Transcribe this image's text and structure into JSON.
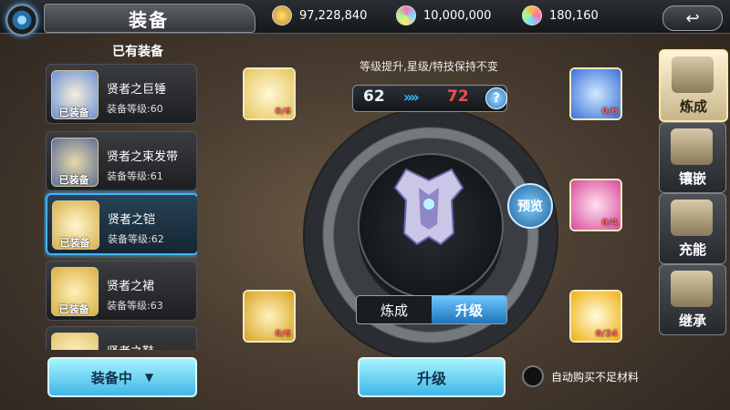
{
  "header": {
    "title": "装备",
    "currencies": [
      {
        "icon": "gold-coin-icon",
        "value": "97,228,840"
      },
      {
        "icon": "crystal-icon",
        "value": "10,000,000"
      },
      {
        "icon": "rainbow-gem-icon",
        "value": "180,160"
      }
    ]
  },
  "owned": {
    "header": "已有装备",
    "items": [
      {
        "name": "贤者之巨锤",
        "level": "装备等级:60",
        "equipped": "已装备",
        "color": "#6a8fd8"
      },
      {
        "name": "贤者之束发带",
        "level": "装备等级:61",
        "equipped": "已装备",
        "color": "#5c6f9a"
      },
      {
        "name": "贤者之铠",
        "level": "装备等级:62",
        "equipped": "已装备",
        "color": "#d9b14a"
      },
      {
        "name": "贤者之裙",
        "level": "装备等级:63",
        "equipped": "已装备",
        "color": "#d8b042"
      },
      {
        "name": "贤者之鞋",
        "level": "",
        "equipped": "",
        "color": "#e6c66a"
      }
    ],
    "equipping_label": "装备中",
    "equipping_arrow": "▼"
  },
  "upgrade": {
    "note": "等级提升,星级/特技保持不变",
    "level_from": "62",
    "level_arrows": "»»",
    "level_to": "72",
    "help": "?",
    "preview": "预览",
    "tabs": [
      "炼成",
      "升级"
    ],
    "active_tab": 1,
    "button": "升级",
    "auto_buy": "自动购买不足材料"
  },
  "materials": [
    {
      "icon": "scroll-icon",
      "count": "0/6"
    },
    {
      "icon": "blue-crystal-icon",
      "count": "0/6"
    },
    {
      "icon": "pink-crystal-icon",
      "count": "0/4"
    },
    {
      "icon": "golden-statue-icon",
      "count": "0/6"
    },
    {
      "icon": "golden-orb-icon",
      "count": "0/24"
    }
  ],
  "side_menu": [
    {
      "label": "炼成",
      "icon": "hammer-icon",
      "active": true
    },
    {
      "label": "镶嵌",
      "icon": "inlay-icon",
      "active": false
    },
    {
      "label": "充能",
      "icon": "charge-icon",
      "active": false
    },
    {
      "label": "继承",
      "icon": "inherit-icon",
      "active": false
    }
  ],
  "colors": {
    "accent": "#3fb5ff",
    "target_level": "#ff4a4a",
    "missing_count": "#ff5b5b"
  }
}
